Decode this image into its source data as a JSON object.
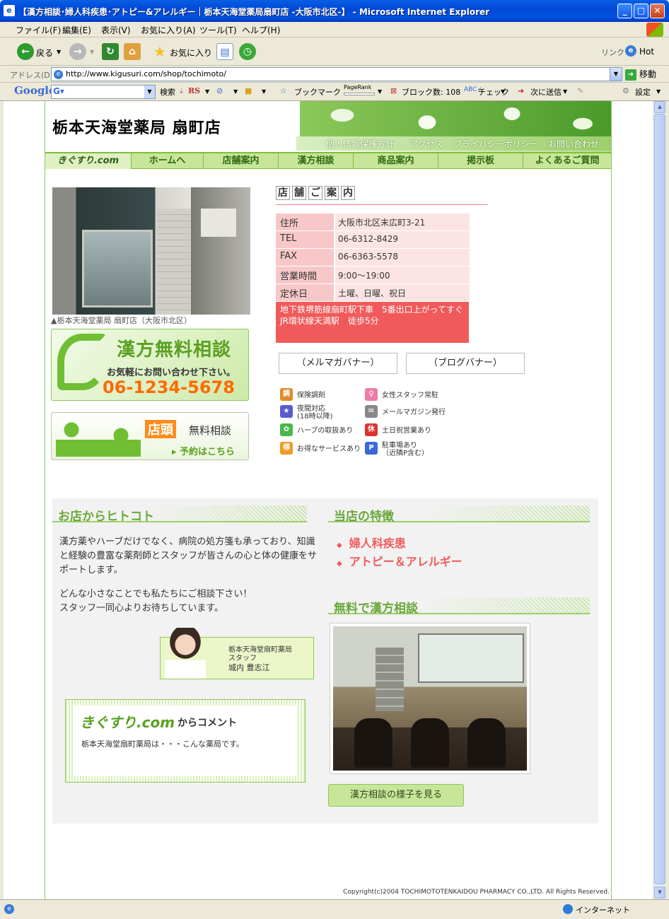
{
  "window": {
    "title": "【漢方相談･婦人科疾患･アトピー&アレルギー｜栃本天海堂薬局扇町店 -大阪市北区-】 - Microsoft Internet Explorer"
  },
  "menu": [
    "ファイル(F)",
    "編集(E)",
    "表示(V)",
    "お気に入り(A)",
    "ツール(T)",
    "ヘルプ(H)"
  ],
  "toolbar": {
    "back": "戻る",
    "favorites": "お気に入り",
    "links": "リンク",
    "hot": "Hot"
  },
  "address": {
    "label": "アドレス(D)",
    "url": "http://www.kigusuri.com/shop/tochimoto/",
    "go": "移動"
  },
  "googlebar": {
    "logo": "Google",
    "search": "検索",
    "rs": "RS",
    "bookmark": "ブックマーク",
    "pagerank": "PageRank",
    "blocked": "ブロック数: 108",
    "check": "チェック",
    "sendto": "次に送信",
    "settings": "設定"
  },
  "site": {
    "shop_name": "栃本天海堂薬局 扇町店",
    "subnav": [
      "個人情報保護方針",
      "アクセス",
      "プライバシーポリシー",
      "お問い合わせ"
    ],
    "gnav": [
      "きぐすり.com",
      "ホームへ",
      "店舗案内",
      "漢方相談",
      "商品案内",
      "掲示板",
      "よくあるご質問"
    ],
    "photo_caption": "▲栃本天海堂薬局 扇町店（大阪市北区）",
    "banner1": {
      "title": "漢方無料相談",
      "sub": "お気軽にお問い合わせ下さい。",
      "phone": "06-1234-5678"
    },
    "banner2": {
      "tag": "店頭",
      "title": "無料相談",
      "link": "▸ 予約はこちら"
    },
    "info_title": [
      "店",
      "舗",
      "ご",
      "案",
      "内"
    ],
    "info": [
      {
        "k": "住所",
        "v": "大阪市北区末広町3-21"
      },
      {
        "k": "TEL",
        "v": "06-6312-8429"
      },
      {
        "k": "FAX",
        "v": "06-6363-5578"
      },
      {
        "k": "営業時間",
        "v": "9:00～19:00"
      },
      {
        "k": "定休日",
        "v": "土曜、日曜、祝日"
      }
    ],
    "access_line1": "地下鉄堺筋線扇町駅下車　5番出口上がってすぐ",
    "access_line2": "JR環状線天満駅　徒歩5分",
    "mailmag_banner": "（メルマガバナー）",
    "blog_banner": "（ブログバナー）",
    "features": [
      {
        "label": "保険調剤",
        "icon": "調",
        "color": "#e08a2a"
      },
      {
        "label": "女性スタッフ常駐",
        "icon": "♀",
        "color": "#f07aa8"
      },
      {
        "label": "夜間対応\n(18時以降)",
        "icon": "★",
        "color": "#5a5ad0"
      },
      {
        "label": "メールマガジン発行",
        "icon": "✉",
        "color": "#888888"
      },
      {
        "label": "ハーブの取扱あり",
        "icon": "✿",
        "color": "#48b848"
      },
      {
        "label": "土日祝営業あり",
        "icon": "休",
        "color": "#e03030"
      },
      {
        "label": "お得なサービスあり",
        "icon": "得",
        "color": "#f09a2a"
      },
      {
        "label": "駐車場あり\n（近隣P含む）",
        "icon": "P",
        "color": "#3a6ad8"
      }
    ],
    "hitokoto_title": "お店からヒトコト",
    "hitokoto_p1": "漢方薬やハーブだけでなく、病院の処方箋も承っており、知識と経験の豊富な薬剤師とスタッフが皆さんの心と体の健康をサポートします。",
    "hitokoto_p2a": "どんな小さなことでも私たちにご相談下さい！",
    "hitokoto_p2b": "スタッフ一同心よりお待ちしています。",
    "staff_org": "栃本天海堂扇町薬局",
    "staff_role": "スタッフ",
    "staff_name": "城内 豊志江",
    "comment_logo": "きぐすり.com",
    "comment_title": "からコメント",
    "comment_text": "栃本天海堂扇町薬局は・・・こんな薬局です。",
    "features_title": "当店の特徴",
    "feature1": "婦人科疾患",
    "feature2": "アトピー＆アレルギー",
    "consult_title": "無料で漢方相談",
    "consult_button": "漢方相談の様子を見る",
    "copyright": "Copyright(c)2004 TOCHIMOTOTENKAIDOU PHARMACY CO.,LTD. All Rights Reserved."
  },
  "status": {
    "zone": "インターネット"
  }
}
